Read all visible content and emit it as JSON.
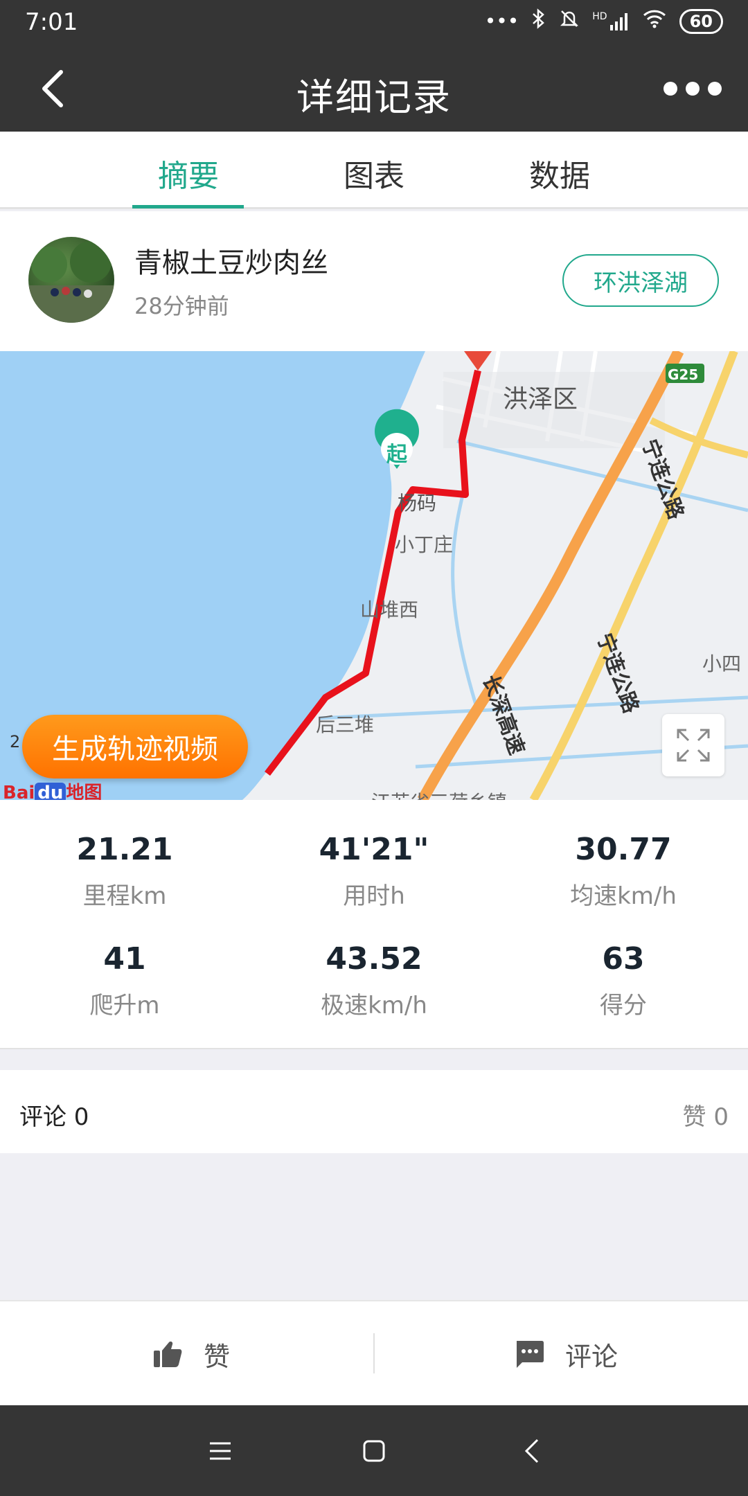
{
  "status_bar": {
    "time": "7:01",
    "signal_label": "HD",
    "battery": "60"
  },
  "header": {
    "title": "详细记录"
  },
  "tabs": [
    {
      "label": "摘要",
      "active": true
    },
    {
      "label": "图表",
      "active": false
    },
    {
      "label": "数据",
      "active": false
    }
  ],
  "user": {
    "name": "青椒土豆炒肉丝",
    "time_ago": "28分钟前",
    "route_tag": "环洪泽湖"
  },
  "map": {
    "labels": {
      "district": "洪泽区",
      "highway_code": "G25",
      "road_a": "宁连公路",
      "road_b": "宁连公路",
      "expressway": "长深高速",
      "village1": "小丁庄",
      "village2": "山堆西",
      "village3": "后三堆",
      "village4": "小四",
      "partial_place": "杨码",
      "bottom_place": "江苏省三荷乡镇"
    },
    "start_marker": "起",
    "scale_digit": "2",
    "generate_video": "生成轨迹视频",
    "logo_bai": "Bai",
    "logo_du": "du",
    "logo_map": "地图",
    "colors": {
      "water": "#9fd0f5",
      "track": "#e8121c",
      "road_orange": "#f7a24a",
      "road_yellow": "#f7d36b",
      "start_marker": "#1fb08e"
    }
  },
  "stats": [
    {
      "value": "21.21",
      "label": "里程km"
    },
    {
      "value": "41'21\"",
      "label": "用时h"
    },
    {
      "value": "30.77",
      "label": "均速km/h"
    },
    {
      "value": "41",
      "label": "爬升m"
    },
    {
      "value": "43.52",
      "label": "极速km/h"
    },
    {
      "value": "63",
      "label": "得分"
    }
  ],
  "comments": {
    "comment_label": "评论 0",
    "like_label": "赞 0"
  },
  "actions": {
    "like": "赞",
    "comment": "评论"
  },
  "theme": {
    "accent": "#21a88c",
    "dark": "#353535"
  }
}
